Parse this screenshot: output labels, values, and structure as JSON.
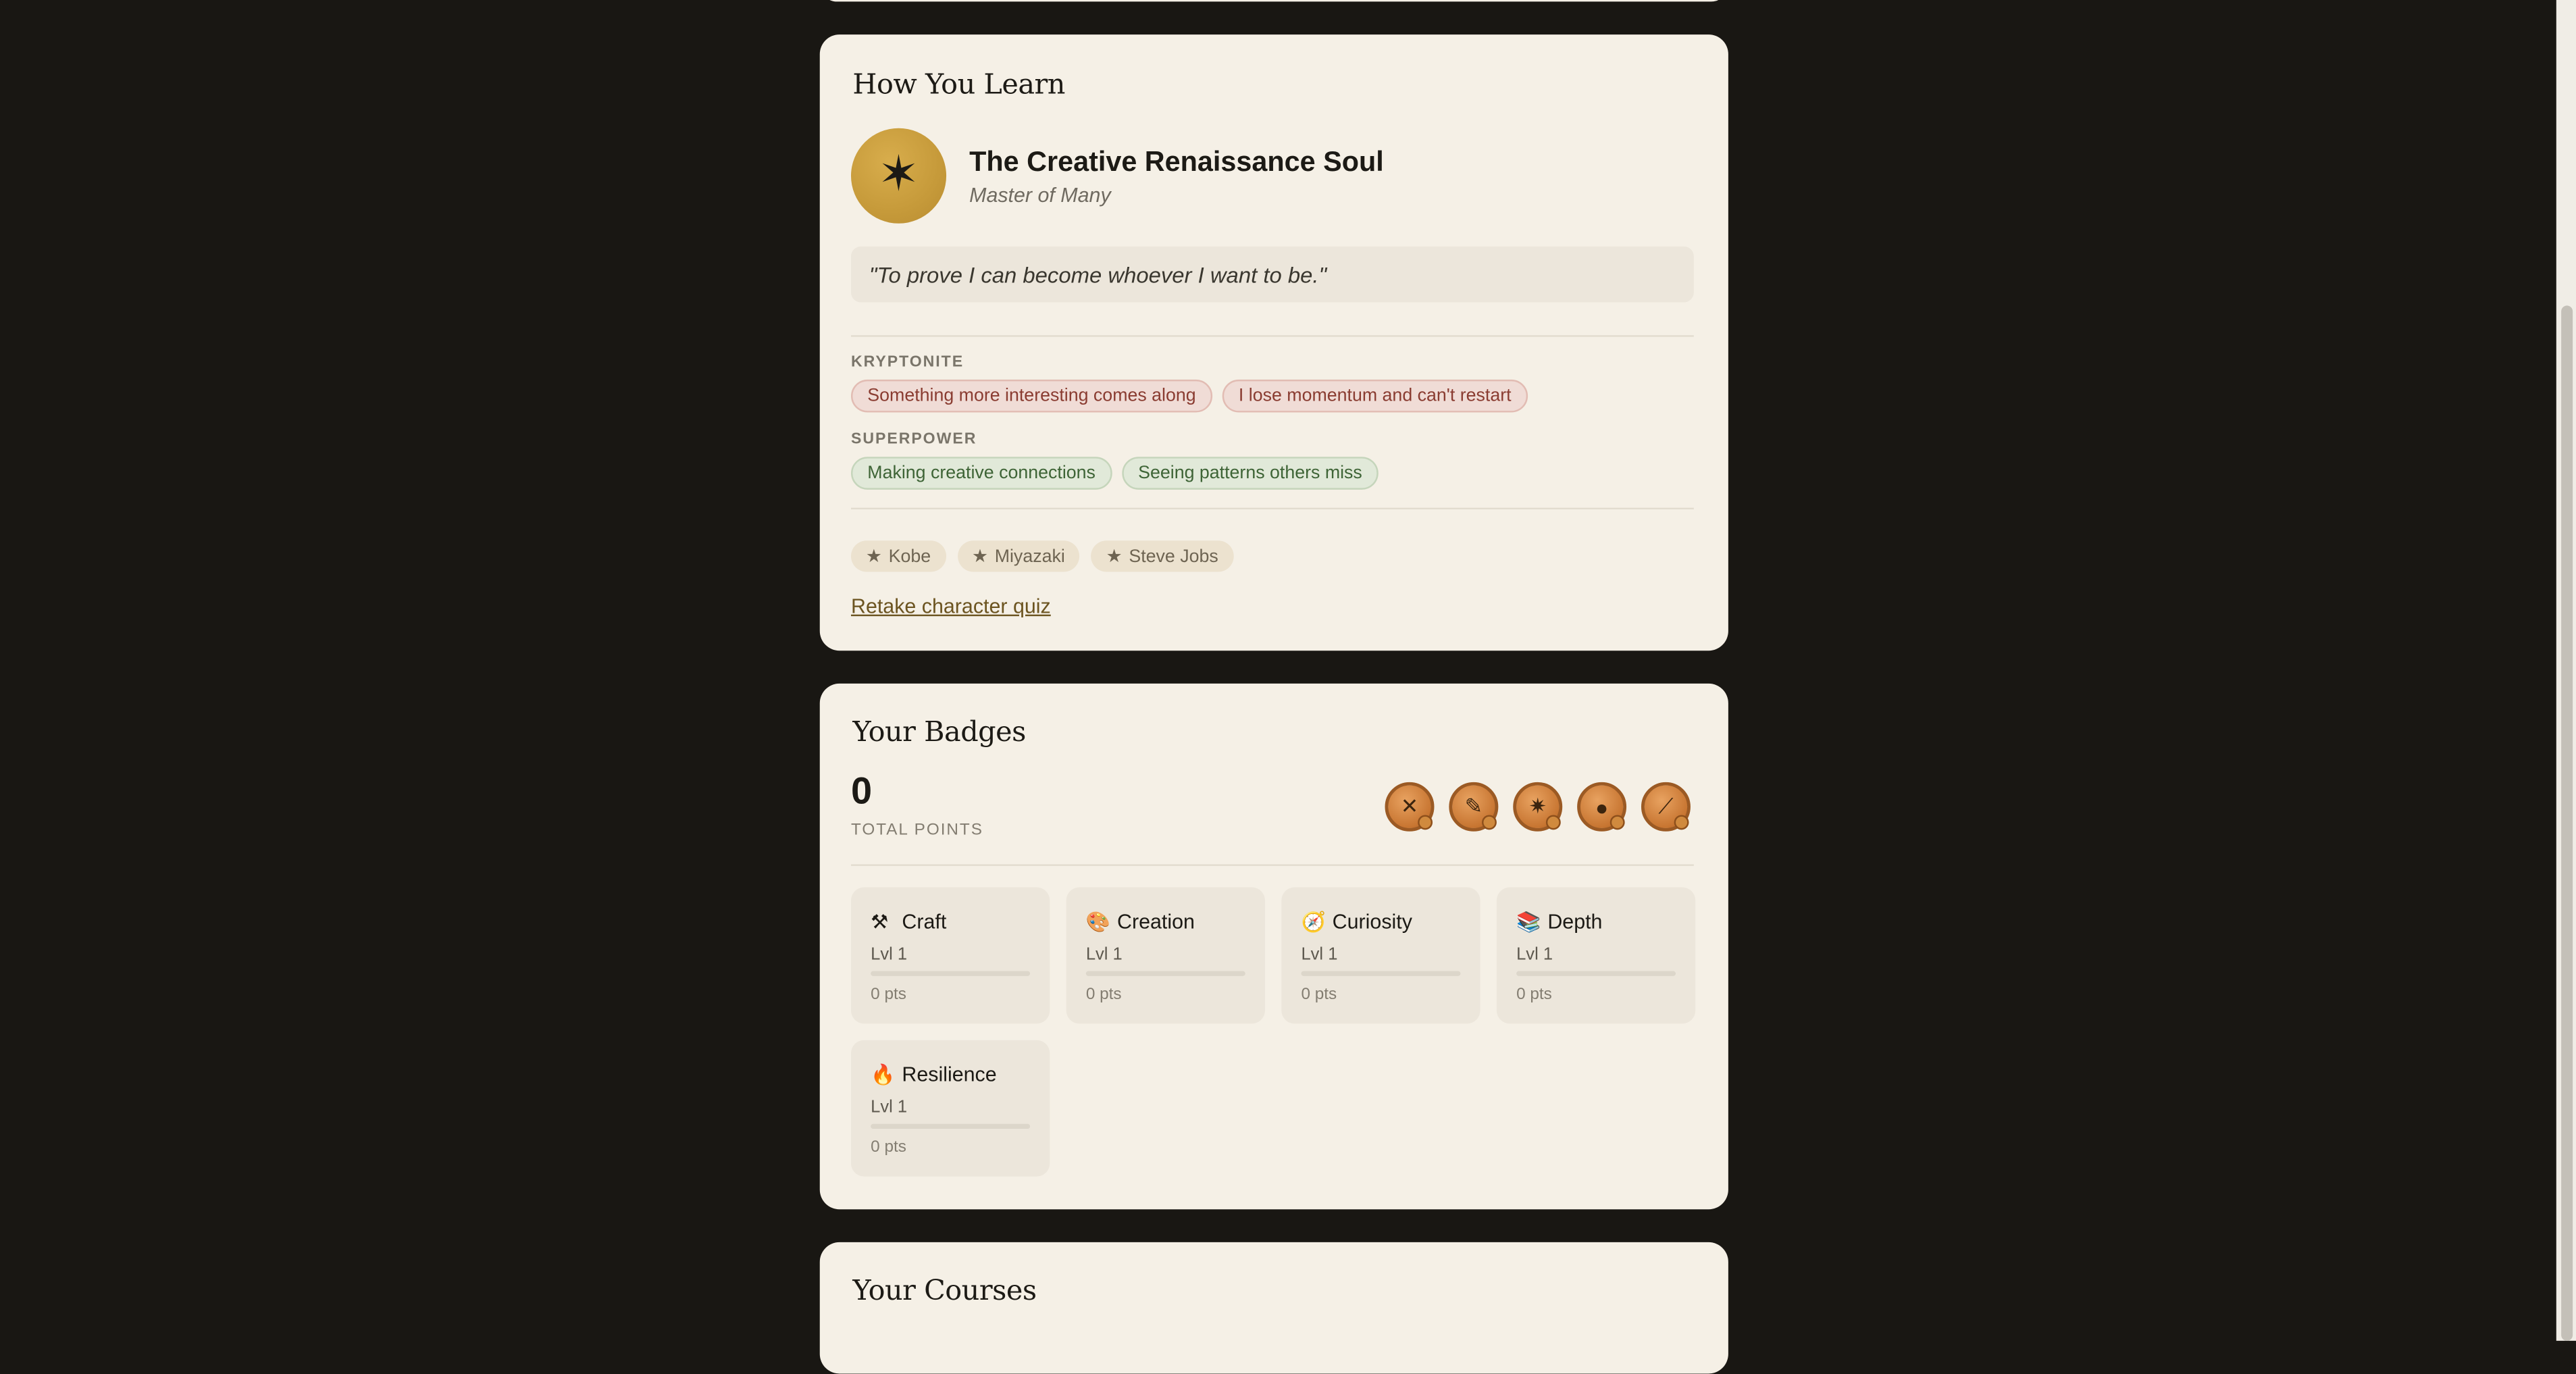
{
  "learn": {
    "title": "How You Learn",
    "emblem_glyph": "✶",
    "character_name": "The Creative Renaissance Soul",
    "character_subtitle": "Master of Many",
    "quote": "\"To prove I can become whoever I want to be.\"",
    "kryptonite_label": "KRYPTONITE",
    "kryptonite": [
      "Something more interesting comes along",
      "I lose momentum and can't restart"
    ],
    "superpower_label": "SUPERPOWER",
    "superpower": [
      "Making creative connections",
      "Seeing patterns others miss"
    ],
    "inspirations": [
      "Kobe",
      "Miyazaki",
      "Steve Jobs"
    ],
    "inspiration_star": "★",
    "retake_link": "Retake character quiz"
  },
  "badges": {
    "title": "Your Badges",
    "total_points": "0",
    "total_points_label": "TOTAL POINTS",
    "medals": [
      {
        "icon": "crossed-tools-icon",
        "glyph": "✕",
        "locked": true
      },
      {
        "icon": "palette-icon",
        "glyph": "✎",
        "locked": true
      },
      {
        "icon": "compass-icon",
        "glyph": "✷",
        "locked": true
      },
      {
        "icon": "book-stack-icon",
        "glyph": "●",
        "locked": true
      },
      {
        "icon": "flame-icon",
        "glyph": "⟋",
        "locked": true
      }
    ],
    "categories": [
      {
        "icon": "hammer-pick-icon",
        "glyph": "⚒",
        "name": "Craft",
        "level": "Lvl 1",
        "progress": 0,
        "points": "0 pts"
      },
      {
        "icon": "palette-icon",
        "glyph": "🎨",
        "name": "Creation",
        "level": "Lvl 1",
        "progress": 0,
        "points": "0 pts"
      },
      {
        "icon": "compass-icon",
        "glyph": "🧭",
        "name": "Curiosity",
        "level": "Lvl 1",
        "progress": 0,
        "points": "0 pts"
      },
      {
        "icon": "books-icon",
        "glyph": "📚",
        "name": "Depth",
        "level": "Lvl 1",
        "progress": 0,
        "points": "0 pts"
      },
      {
        "icon": "fire-icon",
        "glyph": "🔥",
        "name": "Resilience",
        "level": "Lvl 1",
        "progress": 0,
        "points": "0 pts"
      }
    ]
  },
  "courses": {
    "title": "Your Courses"
  },
  "colors": {
    "background": "#191713",
    "card": "#f5f0e6",
    "accent_gold": "#c69a3a",
    "kryptonite_text": "#8a3c31",
    "superpower_text": "#3e6436"
  }
}
